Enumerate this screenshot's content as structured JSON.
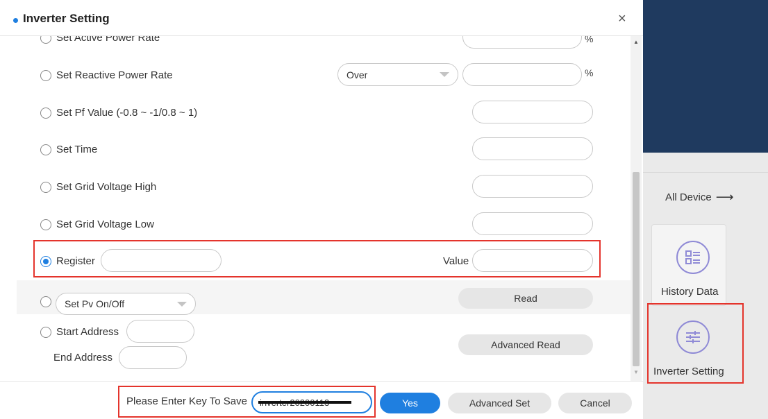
{
  "dialog": {
    "title": "Inverter Setting",
    "close": "×"
  },
  "settings": {
    "active_power_rate": {
      "label": "Set Active Power Rate",
      "unit": "%"
    },
    "reactive_power_rate": {
      "label": "Set Reactive Power Rate",
      "select_value": "Over",
      "unit": "%"
    },
    "pf_value": {
      "label": "Set Pf Value (-0.8 ~ -1/0.8 ~ 1)"
    },
    "time": {
      "label": "Set Time"
    },
    "grid_voltage_high": {
      "label": "Set Grid Voltage High"
    },
    "grid_voltage_low": {
      "label": "Set Grid Voltage Low"
    },
    "register": {
      "label": "Register",
      "value_label": "Value"
    },
    "pv": {
      "select_value": "Set Pv On/Off",
      "read_button": "Read"
    },
    "address": {
      "start_label": "Start Address",
      "end_label": "End Address",
      "advanced_read_button": "Advanced Read"
    }
  },
  "footer": {
    "key_label": "Please Enter Key To Save",
    "key_value": "inverter20200113",
    "yes_button": "Yes",
    "advanced_set_button": "Advanced Set",
    "cancel_button": "Cancel"
  },
  "sidebar": {
    "all_device": "All Device",
    "history_data": "History Data",
    "inverter_setting": "Inverter Setting"
  },
  "colors": {
    "accent": "#1f7fe0",
    "highlight": "#e4342c",
    "navy": "#1f3a5f"
  }
}
